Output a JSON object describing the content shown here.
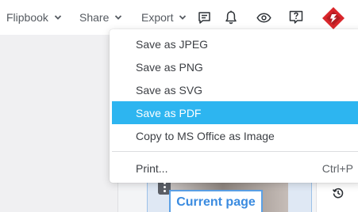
{
  "toolbar": {
    "menus": [
      {
        "label": "Flipbook"
      },
      {
        "label": "Share"
      },
      {
        "label": "Export"
      }
    ],
    "icons": [
      "comment-icon",
      "bell-icon",
      "eye-icon",
      "help-icon"
    ],
    "logo": "app-logo"
  },
  "export_menu": {
    "items": [
      {
        "label": "Save as JPEG",
        "active": false
      },
      {
        "label": "Save as PNG",
        "active": false
      },
      {
        "label": "Save as SVG",
        "active": false
      },
      {
        "label": "Save as PDF",
        "active": true
      },
      {
        "label": "Copy to MS Office as Image",
        "active": false
      }
    ],
    "print": {
      "label": "Print...",
      "shortcut": "Ctrl+P"
    }
  },
  "workspace": {
    "current_page_label": "Current page"
  },
  "colors": {
    "accent": "#2db5f0",
    "logo_red": "#d9262b",
    "current_page_blue": "#3a8be0"
  }
}
